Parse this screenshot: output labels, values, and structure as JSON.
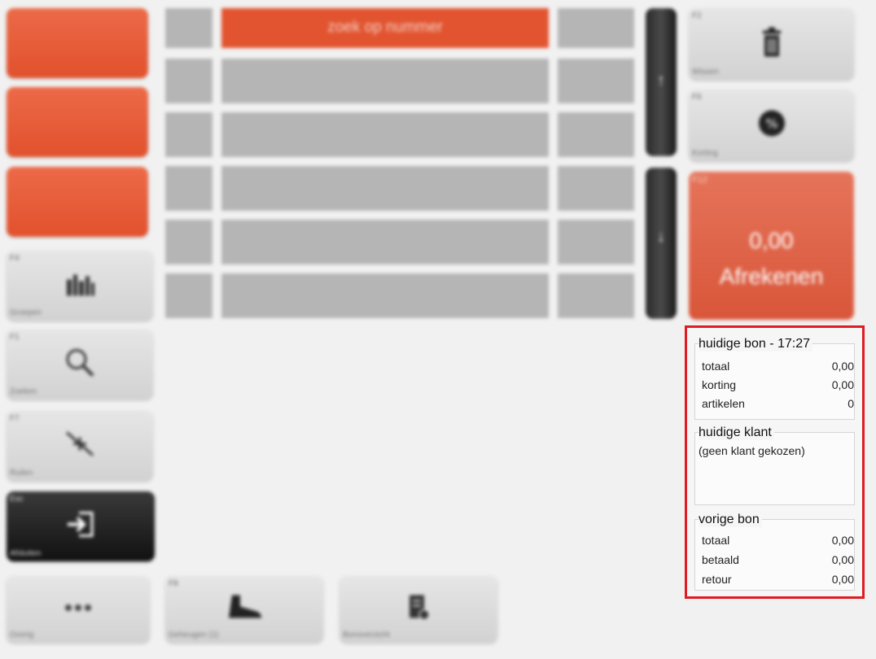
{
  "search": {
    "label": "zoek op nummer"
  },
  "left_buttons": [
    {
      "key": "F4",
      "label": "Groepen",
      "icon": "bottles-icon"
    },
    {
      "key": "F1",
      "label": "Zoeken",
      "icon": "search-icon"
    },
    {
      "key": "F7",
      "label": "Ruilen",
      "icon": "exchange-arrows-icon"
    },
    {
      "key": "Esc",
      "label": "Afsluiten",
      "icon": "exit-door-icon"
    }
  ],
  "bottom_buttons": [
    {
      "key": "",
      "label": "Overig",
      "icon": "more-dots-icon"
    },
    {
      "key": "F8",
      "label": "Geheugen (1)",
      "icon": "shoe-icon"
    },
    {
      "key": "",
      "label": "Bonoverzicht",
      "icon": "receipt-list-icon"
    }
  ],
  "right_buttons": [
    {
      "key": "F2",
      "label": "Wissen",
      "icon": "trash-icon"
    },
    {
      "key": "F6",
      "label": "Korting",
      "icon": "percent-icon"
    }
  ],
  "pay": {
    "key": "F12",
    "amount": "0,00",
    "label": "Afrekenen"
  },
  "scroll": {
    "up_icon": "arrow-up-icon",
    "down_icon": "arrow-down-icon"
  },
  "current_receipt": {
    "title": "huidige bon - 17:27",
    "rows": [
      {
        "label": "totaal",
        "value": "0,00"
      },
      {
        "label": "korting",
        "value": "0,00"
      },
      {
        "label": "artikelen",
        "value": "0"
      }
    ]
  },
  "current_customer": {
    "title": "huidige klant",
    "text": "(geen klant gekozen)"
  },
  "previous_receipt": {
    "title": "vorige bon",
    "rows": [
      {
        "label": "totaal",
        "value": "0,00"
      },
      {
        "label": "betaald",
        "value": "0,00"
      },
      {
        "label": "retour",
        "value": "0,00"
      }
    ]
  },
  "colors": {
    "accent": "#e2512d",
    "highlight_border": "#e01b22",
    "dark_button": "#1a1a1a"
  }
}
